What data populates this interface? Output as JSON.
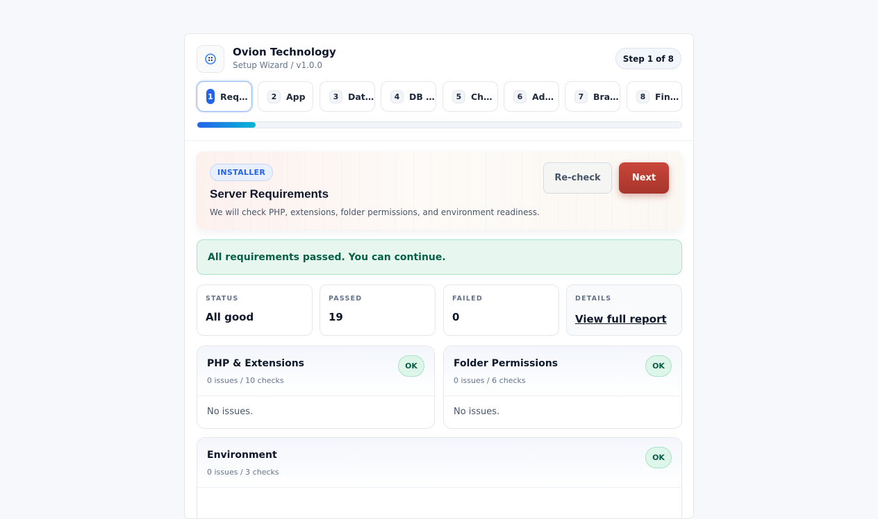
{
  "header": {
    "brand_name": "Ovion Technology",
    "brand_sub": "Setup Wizard / v1.0.0",
    "step_word": "Step",
    "step_current": "1",
    "step_of": "of",
    "step_total": "8"
  },
  "steps": [
    {
      "num": "1",
      "label": "Requirements",
      "active": true
    },
    {
      "num": "2",
      "label": "App",
      "active": false
    },
    {
      "num": "3",
      "label": "Database",
      "active": false
    },
    {
      "num": "4",
      "label": "DB Setup",
      "active": false
    },
    {
      "num": "5",
      "label": "Channels",
      "active": false
    },
    {
      "num": "6",
      "label": "Admin",
      "active": false
    },
    {
      "num": "7",
      "label": "Branding",
      "active": false
    },
    {
      "num": "8",
      "label": "Finish",
      "active": false
    }
  ],
  "progress": {
    "fraction": 0.12
  },
  "hero": {
    "badge": "INSTALLER",
    "title": "Server Requirements",
    "description": "We will check PHP, extensions, folder permissions, and environment readiness.",
    "recheck_label": "Re-check",
    "next_label": "Next"
  },
  "alert": {
    "message": "All requirements passed. You can continue."
  },
  "stats": {
    "status_label": "STATUS",
    "status_value": "All good",
    "passed_label": "PASSED",
    "passed_value": "19",
    "failed_label": "FAILED",
    "failed_value": "0",
    "details_label": "DETAILS",
    "details_link": "View full report"
  },
  "panels": {
    "php": {
      "title": "PHP & Extensions",
      "subtitle": "0 issues / 10 checks",
      "badge": "OK",
      "body": "No issues."
    },
    "folders": {
      "title": "Folder Permissions",
      "subtitle": "0 issues / 6 checks",
      "badge": "OK",
      "body": "No issues."
    },
    "environment": {
      "title": "Environment",
      "subtitle": "0 issues / 3 checks",
      "badge": "OK"
    }
  },
  "icons": {
    "logo": "grid-logo-icon"
  },
  "colors": {
    "primary": "#2563eb",
    "accent": "#06b6d4",
    "next_button": "#b83d31",
    "success_bg": "#e7f7ef",
    "success_text": "#065f46"
  }
}
